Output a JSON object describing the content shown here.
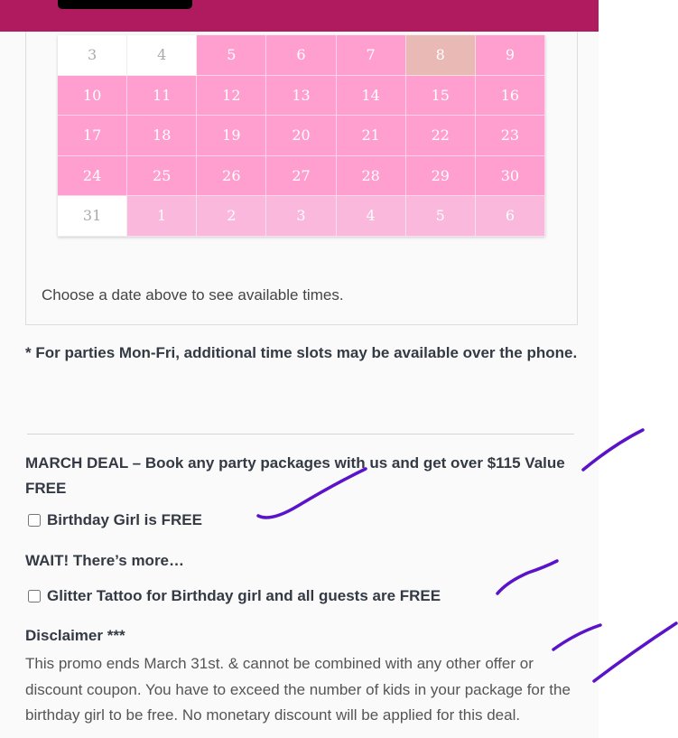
{
  "calendar": {
    "rows": [
      [
        {
          "day": "3",
          "state": "disabled"
        },
        {
          "day": "4",
          "state": "disabled"
        },
        {
          "day": "5",
          "state": "available"
        },
        {
          "day": "6",
          "state": "available"
        },
        {
          "day": "7",
          "state": "available"
        },
        {
          "day": "8",
          "state": "today"
        },
        {
          "day": "9",
          "state": "available"
        }
      ],
      [
        {
          "day": "10",
          "state": "available"
        },
        {
          "day": "11",
          "state": "available"
        },
        {
          "day": "12",
          "state": "available"
        },
        {
          "day": "13",
          "state": "available"
        },
        {
          "day": "14",
          "state": "available"
        },
        {
          "day": "15",
          "state": "available"
        },
        {
          "day": "16",
          "state": "available"
        }
      ],
      [
        {
          "day": "17",
          "state": "available"
        },
        {
          "day": "18",
          "state": "available"
        },
        {
          "day": "19",
          "state": "available"
        },
        {
          "day": "20",
          "state": "available"
        },
        {
          "day": "21",
          "state": "available"
        },
        {
          "day": "22",
          "state": "available"
        },
        {
          "day": "23",
          "state": "available"
        }
      ],
      [
        {
          "day": "24",
          "state": "available"
        },
        {
          "day": "25",
          "state": "available"
        },
        {
          "day": "26",
          "state": "available"
        },
        {
          "day": "27",
          "state": "available"
        },
        {
          "day": "28",
          "state": "available"
        },
        {
          "day": "29",
          "state": "available"
        },
        {
          "day": "30",
          "state": "available"
        }
      ],
      [
        {
          "day": "31",
          "state": "disabled"
        },
        {
          "day": "1",
          "state": "next"
        },
        {
          "day": "2",
          "state": "next"
        },
        {
          "day": "3",
          "state": "next"
        },
        {
          "day": "4",
          "state": "next"
        },
        {
          "day": "5",
          "state": "next"
        },
        {
          "day": "6",
          "state": "next"
        }
      ]
    ]
  },
  "booking": {
    "choose_text": "Choose a date above to see available times."
  },
  "note": "* For parties Mon-Fri, additional time slots may be available over the phone.",
  "deal": {
    "title": "MARCH DEAL – Book any party packages with us and get over $115 Value FREE",
    "option1": "Birthday Girl is FREE",
    "wait_title": "WAIT! There’s more…",
    "option2": "Glitter Tattoo for Birthday girl and all guests are FREE",
    "disclaimer_title": "Disclaimer ***",
    "disclaimer_body": "This promo ends March 31st. & cannot be combined with any other offer or discount coupon. You have to exceed the number of kids in your package for the birthday girl to be free. No monetary discount will be applied for this deal."
  },
  "colors": {
    "header": "#b01a5e",
    "available": "#ff9fd0",
    "today": "#e8b9b5",
    "next_month": "#f9b8dc",
    "ink": "#5a13c9"
  }
}
